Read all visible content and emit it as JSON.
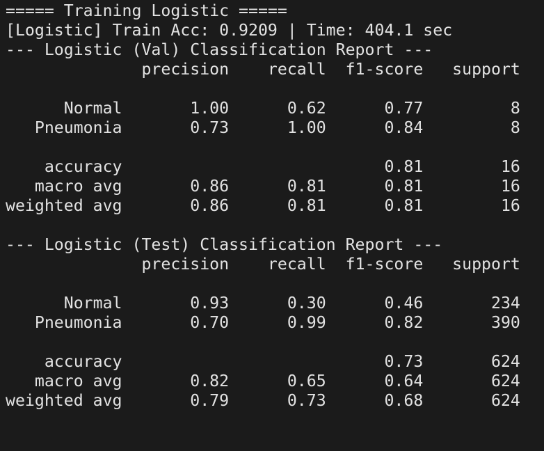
{
  "terminal": {
    "lines": [
      "===== Training Logistic =====",
      "[Logistic] Train Acc: 0.9209 | Time: 404.1 sec",
      "--- Logistic (Val) Classification Report ---",
      "              precision    recall  f1-score   support",
      "",
      "      Normal       1.00      0.62      0.77         8",
      "   Pneumonia       0.73      1.00      0.84         8",
      "",
      "    accuracy                           0.81        16",
      "   macro avg       0.86      0.81      0.81        16",
      "weighted avg       0.86      0.81      0.81        16",
      "",
      "--- Logistic (Test) Classification Report ---",
      "              precision    recall  f1-score   support",
      "",
      "      Normal       0.93      0.30      0.46       234",
      "   Pneumonia       0.70      0.99      0.82       390",
      "",
      "    accuracy                           0.73       624",
      "   macro avg       0.82      0.65      0.64       624",
      "weighted avg       0.79      0.73      0.68       624"
    ]
  },
  "colors": {
    "background": "#1b1b1b",
    "foreground": "#e2e2e2"
  }
}
